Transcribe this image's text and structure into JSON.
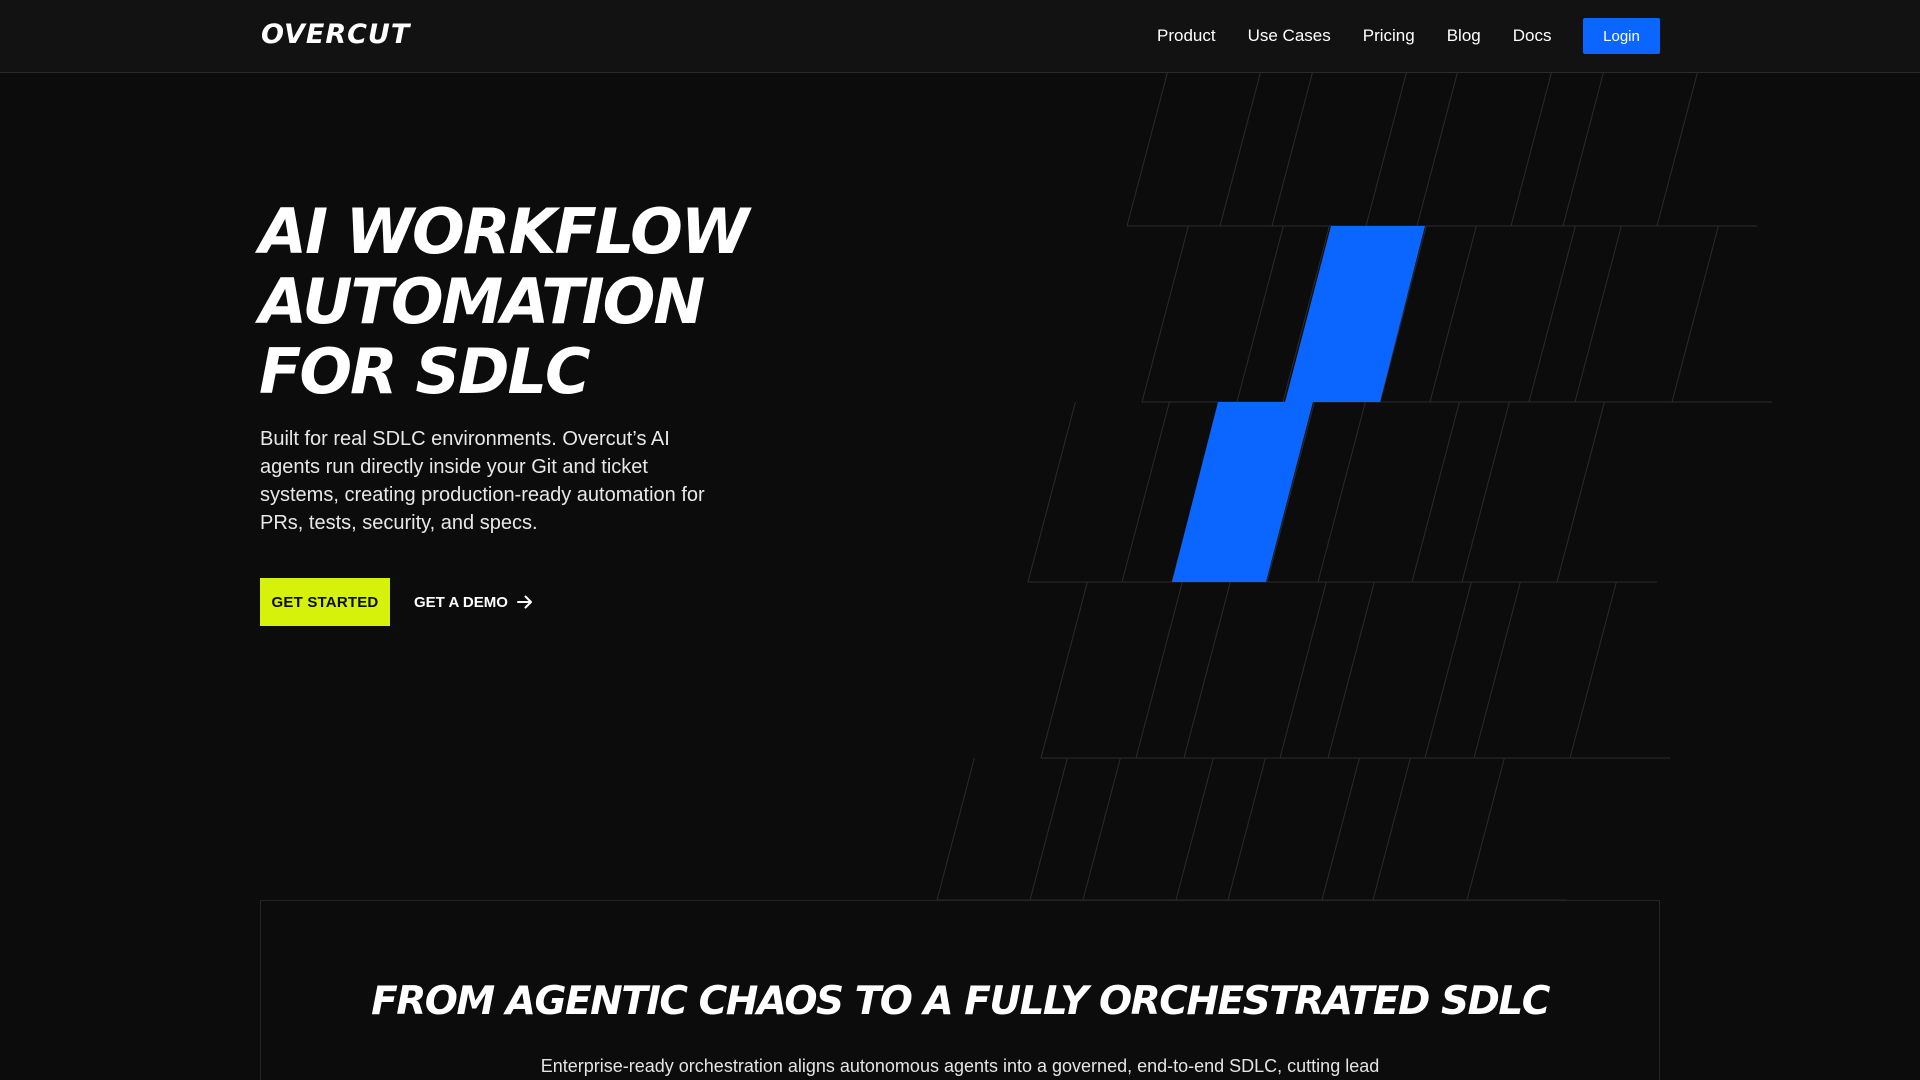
{
  "brand": {
    "logo": "OVERCUT"
  },
  "nav": {
    "links": [
      "Product",
      "Use Cases",
      "Pricing",
      "Blog",
      "Docs"
    ],
    "login_label": "Login"
  },
  "hero": {
    "title_lines": [
      "AI WORKFLOW",
      "AUTOMATION",
      "FOR SDLC"
    ],
    "description": "Built for real SDLC environments. Overcut’s AI agents run directly inside your Git and ticket systems, creating production-ready automation for PRs, tests, security, and specs.",
    "primary_cta": "GET STARTED",
    "secondary_cta": "GET A DEMO",
    "secondary_cta_icon": "arrow-right-icon"
  },
  "section": {
    "title": "FROM AGENTIC CHAOS TO A FULLY ORCHESTRATED SDLC",
    "subtitle": "Enterprise-ready orchestration aligns autonomous agents into a governed, end-to-end SDLC, cutting lead"
  },
  "colors": {
    "background": "#0c0c0c",
    "nav_background": "#121212",
    "accent_blue": "#0a66ff",
    "accent_lime": "#d6f20a",
    "pattern_line": "#2b2b2b"
  }
}
